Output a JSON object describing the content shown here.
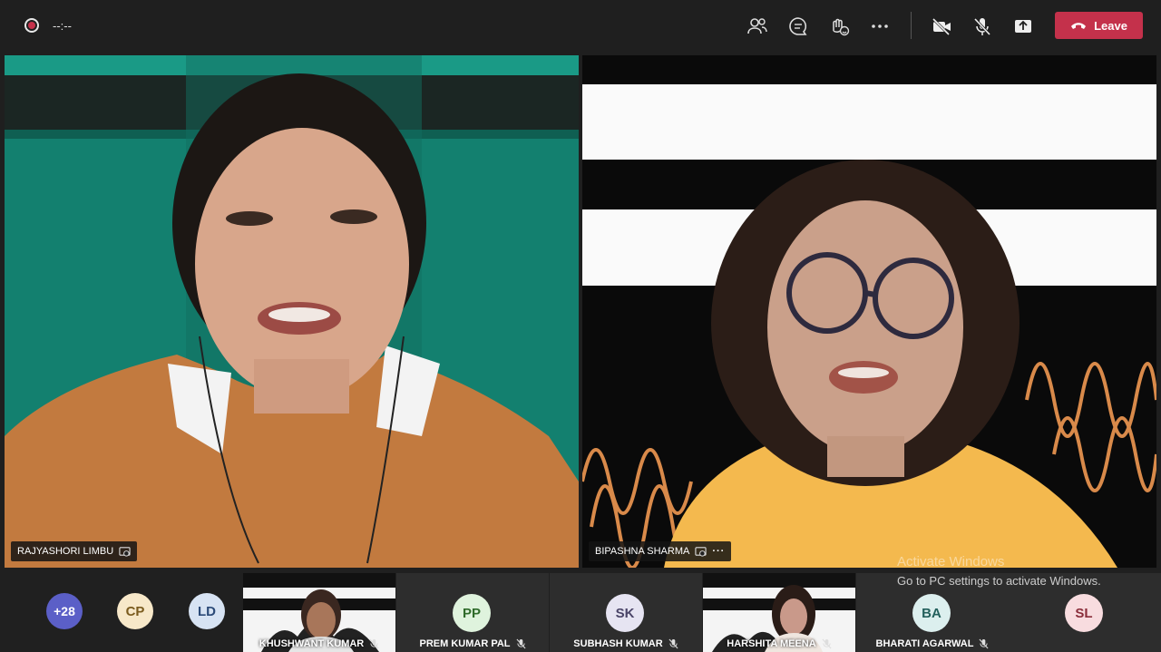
{
  "window": {
    "timer": "--:--"
  },
  "toolbar": {
    "icons": [
      "participants-icon",
      "chat-icon",
      "reactions-icon",
      "more-icon",
      "camera-off-icon",
      "mic-off-icon",
      "share-icon"
    ],
    "leave_label": "Leave",
    "leave_color": "#c4314b"
  },
  "main": {
    "left_name": "RAJYASHORI LIMBU",
    "right_name": "BIPASHNA SHARMA",
    "right_more": "···"
  },
  "strip": {
    "overflow": "+28",
    "avatars": [
      {
        "initials": "CP",
        "bg": "#f7e8c9",
        "fg": "#7a5b1e"
      },
      {
        "initials": "LD",
        "bg": "#d7e3f3",
        "fg": "#2b4a78"
      }
    ],
    "tiles": [
      {
        "name": "KHUSHWANT KUMAR",
        "type": "video"
      },
      {
        "name": "PREM KUMAR PAL",
        "initials": "PP",
        "bg": "#dff3dd",
        "fg": "#2f6b2a"
      },
      {
        "name": "SUBHASH KUMAR",
        "initials": "SK",
        "bg": "#e6e4f2",
        "fg": "#4a4468"
      },
      {
        "name": "HARSHITA MEENA",
        "type": "video"
      },
      {
        "name": "BHARATI AGARWAL",
        "initials": "BA",
        "bg": "#dcefee",
        "fg": "#23605c"
      },
      {
        "initials": "SL",
        "bg": "#f8dcdf",
        "fg": "#8a2d3a"
      }
    ]
  },
  "watermark": {
    "line1": "Activate Windows",
    "line2": "Go to PC settings to activate Windows."
  }
}
